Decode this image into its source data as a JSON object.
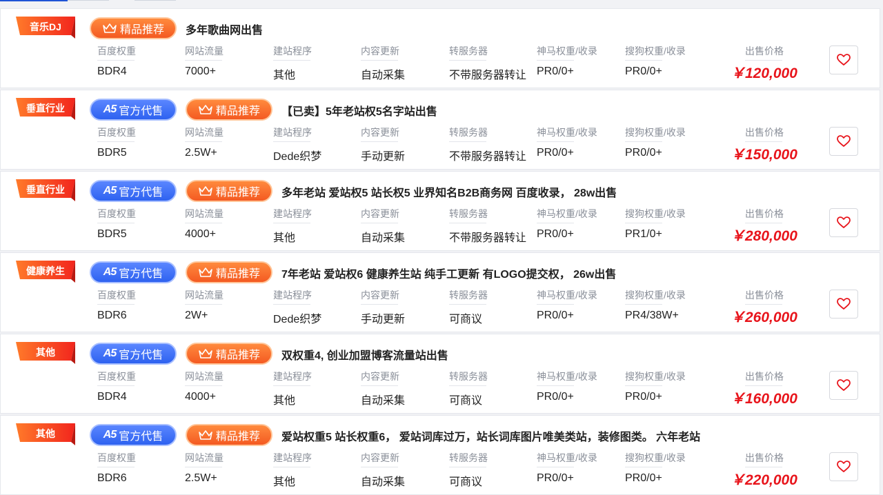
{
  "labels": {
    "baidu": "百度权重",
    "traffic": "网站流量",
    "program": "建站程序",
    "update": "内容更新",
    "server": "转服务器",
    "shenma": "神马权重/收录",
    "sogou": "搜狗权重/收录",
    "price": "出售价格"
  },
  "badges": {
    "official_brand": "A5",
    "official_text": "官方代售",
    "recommend_text": "精品推荐"
  },
  "colors": {
    "price": "#e8141b",
    "official": "#2e62f0",
    "recommend": "#f45a22",
    "category": "#f23b1b",
    "heart": "#e8141b"
  },
  "listings": [
    {
      "category": "音乐DJ",
      "official": false,
      "recommended": true,
      "title": "多年歌曲网出售",
      "baidu": "BDR4",
      "traffic": "7000+",
      "program": "其他",
      "update": "自动采集",
      "server": "不带服务器转让",
      "shenma": "PR0/0+",
      "sogou": "PR0/0+",
      "price": "￥120,000"
    },
    {
      "category": "垂直行业",
      "official": true,
      "recommended": true,
      "title": "【已卖】5年老站权5名字站出售",
      "baidu": "BDR5",
      "traffic": "2.5W+",
      "program": "Dede织梦",
      "update": "手动更新",
      "server": "不带服务器转让",
      "shenma": "PR0/0+",
      "sogou": "PR0/0+",
      "price": "￥150,000"
    },
    {
      "category": "垂直行业",
      "official": true,
      "recommended": true,
      "title": "多年老站 爱站权5 站长权5 业界知名B2B商务网 百度收录， 28w出售",
      "baidu": "BDR5",
      "traffic": "4000+",
      "program": "其他",
      "update": "自动采集",
      "server": "不带服务器转让",
      "shenma": "PR0/0+",
      "sogou": "PR1/0+",
      "price": "￥280,000"
    },
    {
      "category": "健康养生",
      "official": true,
      "recommended": true,
      "title": "7年老站 爱站权6 健康养生站 纯手工更新 有LOGO提交权， 26w出售",
      "baidu": "BDR6",
      "traffic": "2W+",
      "program": "Dede织梦",
      "update": "手动更新",
      "server": "可商议",
      "shenma": "PR0/0+",
      "sogou": "PR4/38W+",
      "price": "￥260,000"
    },
    {
      "category": "其他",
      "official": true,
      "recommended": true,
      "title": "双权重4, 创业加盟博客流量站出售",
      "baidu": "BDR4",
      "traffic": "4000+",
      "program": "其他",
      "update": "自动采集",
      "server": "可商议",
      "shenma": "PR0/0+",
      "sogou": "PR0/0+",
      "price": "￥160,000"
    },
    {
      "category": "其他",
      "official": true,
      "recommended": true,
      "title": "爱站权重5 站长权重6， 爱站词库过万，站长词库图片唯美类站，装修图类。 六年老站",
      "baidu": "BDR6",
      "traffic": "2.5W+",
      "program": "其他",
      "update": "自动采集",
      "server": "可商议",
      "shenma": "PR0/0+",
      "sogou": "PR0/0+",
      "price": "￥220,000"
    }
  ]
}
